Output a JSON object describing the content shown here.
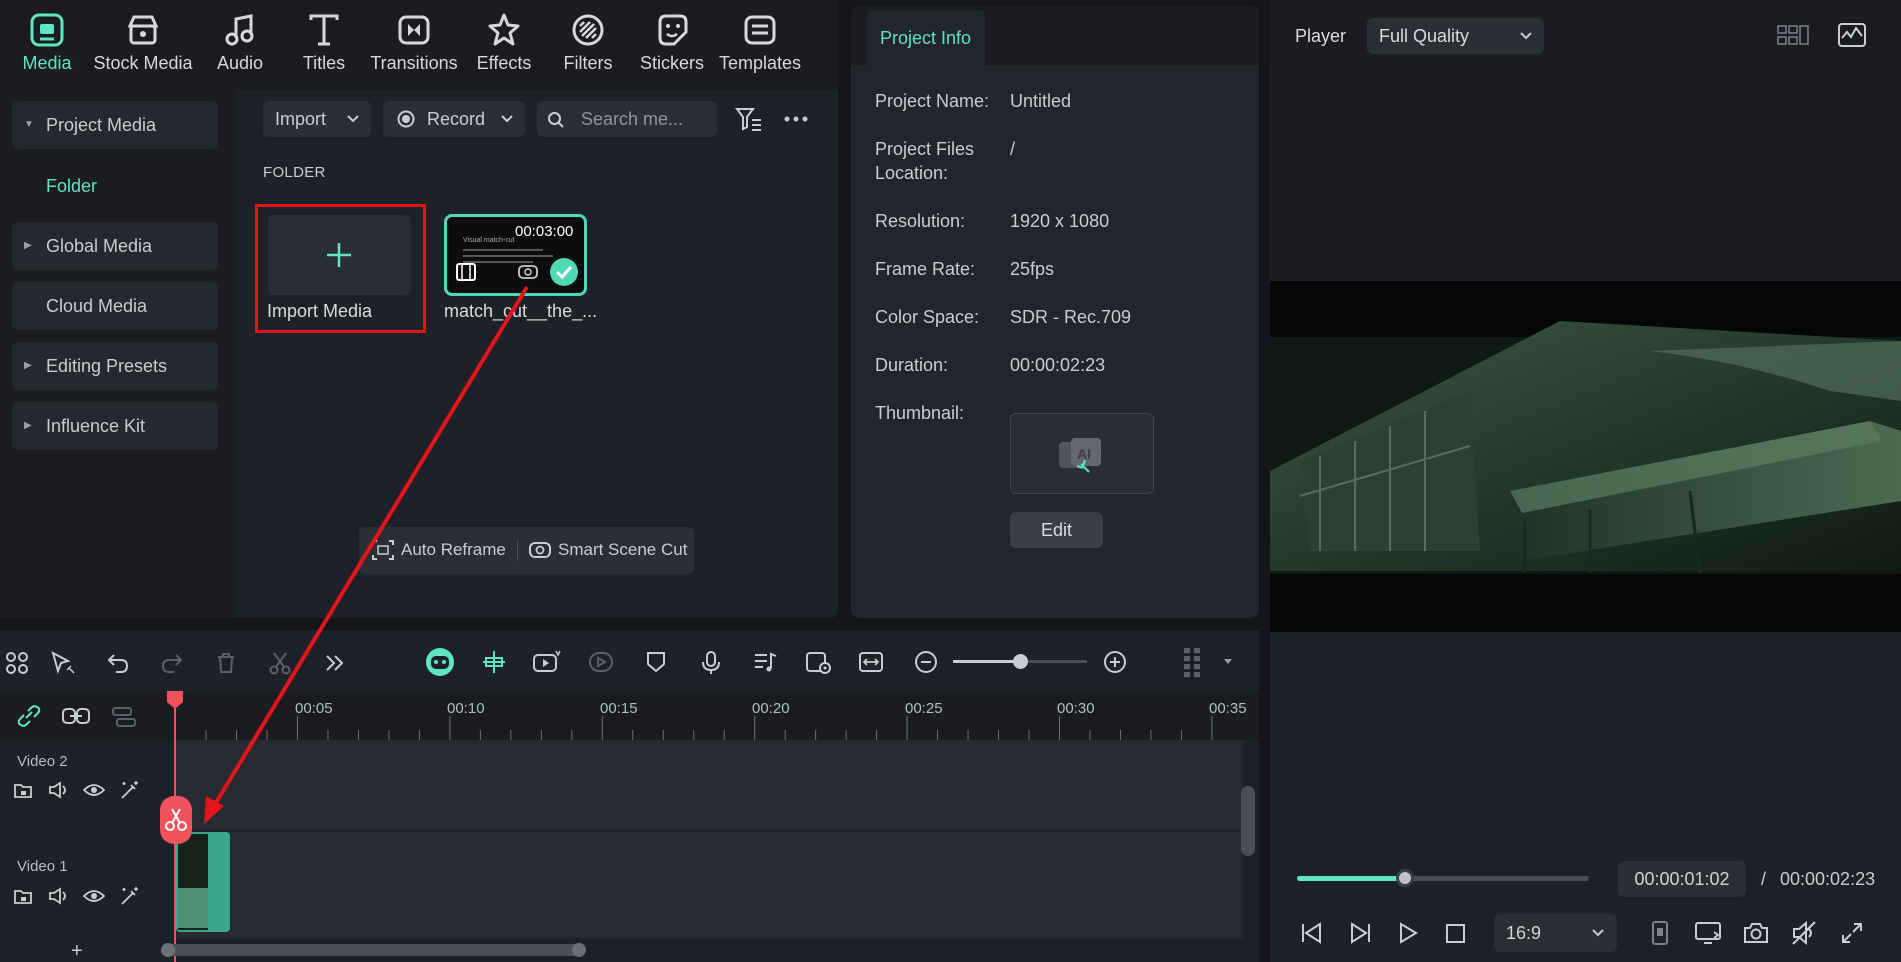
{
  "top_tabs": [
    {
      "label": "Media",
      "active": true
    },
    {
      "label": "Stock Media"
    },
    {
      "label": "Audio"
    },
    {
      "label": "Titles"
    },
    {
      "label": "Transitions"
    },
    {
      "label": "Effects"
    },
    {
      "label": "Filters"
    },
    {
      "label": "Stickers"
    },
    {
      "label": "Templates"
    }
  ],
  "left_nav": {
    "project_media": "Project Media",
    "folder": "Folder",
    "global_media": "Global Media",
    "cloud_media": "Cloud Media",
    "editing_presets": "Editing Presets",
    "influence_kit": "Influence Kit"
  },
  "media_toolbar": {
    "import_label": "Import",
    "record_label": "Record",
    "search_placeholder": "Search me..."
  },
  "media_area": {
    "folder_label": "FOLDER",
    "import_media_label": "Import Media",
    "clip": {
      "duration": "00:03:00",
      "name": "match_cut__the_...",
      "thumb_title": "Visual match-cut"
    }
  },
  "ai_tools": {
    "auto_reframe": "Auto Reframe",
    "smart_scene_cut": "Smart Scene Cut"
  },
  "project_info": {
    "tab_label": "Project Info",
    "project_name_label": "Project Name:",
    "project_name": "Untitled",
    "files_location_label_1": "Project Files",
    "files_location_label_2": "Location:",
    "files_location": "/",
    "resolution_label": "Resolution:",
    "resolution": "1920 x 1080",
    "frame_rate_label": "Frame Rate:",
    "frame_rate": "25fps",
    "color_space_label": "Color Space:",
    "color_space": "SDR - Rec.709",
    "duration_label": "Duration:",
    "duration": "00:00:02:23",
    "thumbnail_label": "Thumbnail:",
    "edit_label": "Edit"
  },
  "player": {
    "label": "Player",
    "quality": "Full Quality",
    "current_time": "00:00:01:02",
    "separator": "/",
    "total_time": "00:00:02:23",
    "progress": 0.37,
    "aspect_ratio": "16:9"
  },
  "timeline": {
    "ruler_labels": [
      "00:05",
      "00:10",
      "00:15",
      "00:20",
      "00:25",
      "00:30",
      "00:35"
    ],
    "tracks": [
      {
        "name": "Video 2"
      },
      {
        "name": "Video 1"
      }
    ],
    "add_track": "+",
    "zoom_level": 0.5
  },
  "colors": {
    "accent": "#5ee6c3",
    "highlight_box": "#e3141b",
    "playhead": "#f0535b"
  }
}
